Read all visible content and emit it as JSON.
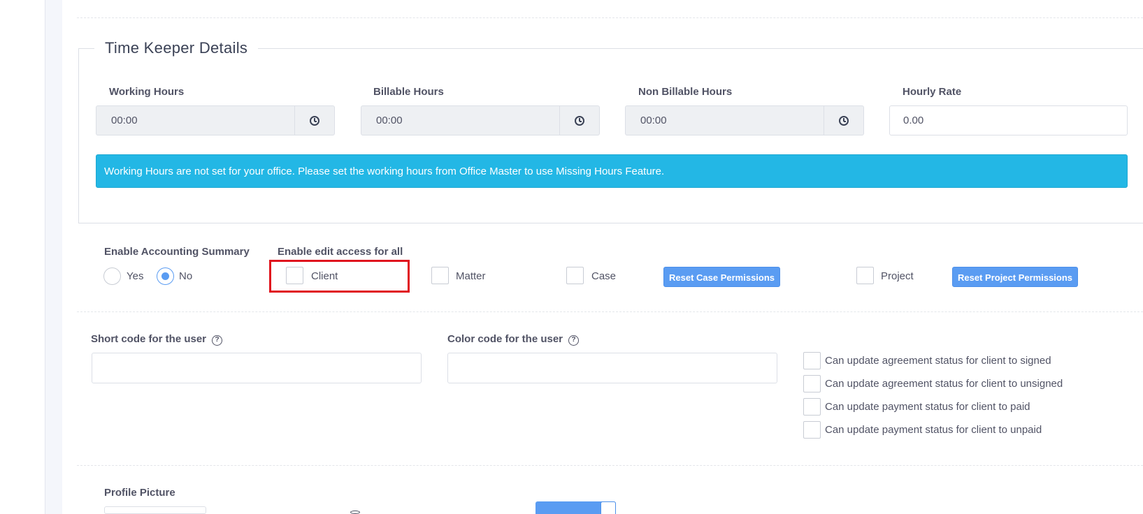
{
  "time_keeper": {
    "legend": "Time Keeper Details",
    "working_hours": {
      "label": "Working Hours",
      "value": "00:00"
    },
    "billable_hours": {
      "label": "Billable Hours",
      "value": "00:00"
    },
    "non_billable_hours": {
      "label": "Non Billable Hours",
      "value": "00:00"
    },
    "hourly_rate": {
      "label": "Hourly Rate",
      "value": "0.00"
    },
    "alert": "Working Hours are not set for your office. Please set the working hours from Office Master to use Missing Hours Feature."
  },
  "accounting": {
    "label": "Enable Accounting Summary",
    "yes": "Yes",
    "no": "No",
    "selected": "No"
  },
  "edit_access": {
    "label": "Enable edit access for all",
    "client": "Client",
    "matter": "Matter",
    "case": "Case",
    "reset_case": "Reset Case Permissions",
    "project": "Project",
    "reset_project": "Reset Project Permissions"
  },
  "codes": {
    "short_code_label": "Short code for the user",
    "short_code_value": "",
    "color_code_label": "Color code for the user",
    "color_code_value": "",
    "help_glyph": "?"
  },
  "permissions": [
    "Can update agreement status for client to signed",
    "Can update agreement status for client to unsigned",
    "Can update payment status for client to paid",
    "Can update payment status for client to unpaid"
  ],
  "profile": {
    "label": "Profile Picture"
  },
  "colors": {
    "accent": "#5a9cf2",
    "info_alert": "#23b7e5",
    "highlight": "#e0141e"
  }
}
